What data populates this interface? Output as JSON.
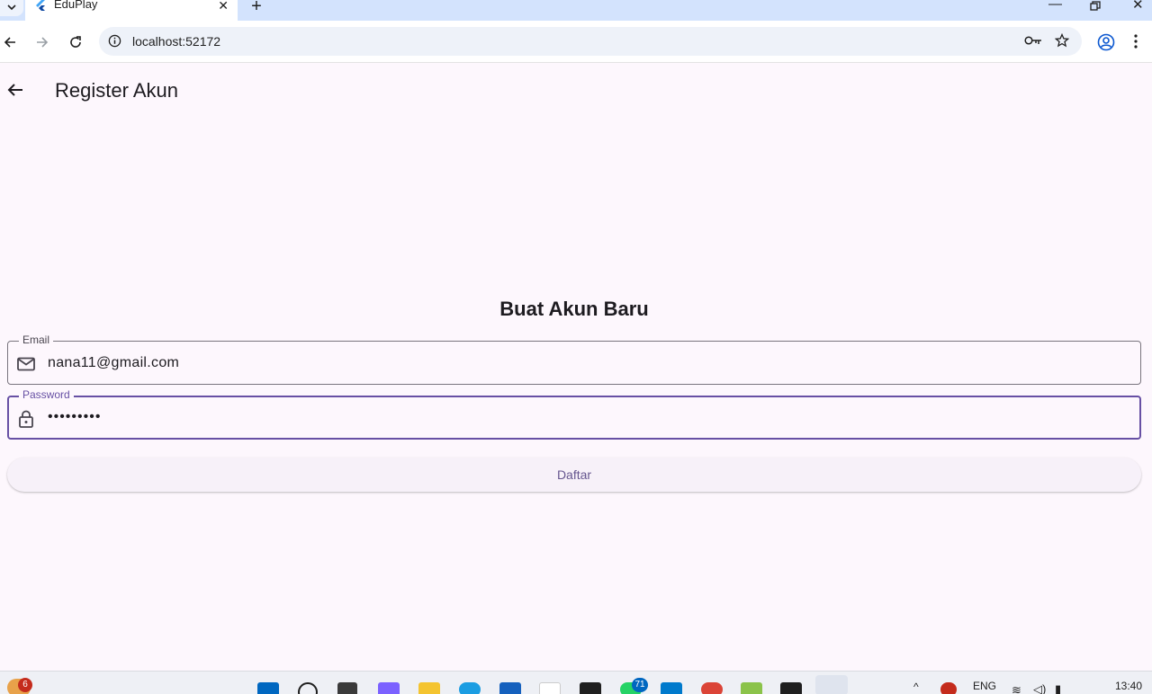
{
  "browser": {
    "tab_title": "EduPlay",
    "url": "localhost:52172"
  },
  "app": {
    "appbar_title": "Register Akun",
    "heading": "Buat Akun Baru",
    "email": {
      "label": "Email",
      "value": "nana11@gmail.com"
    },
    "password": {
      "label": "Password",
      "value": "•••••••••"
    },
    "submit_label": "Daftar"
  },
  "taskbar": {
    "notification_badge": "6",
    "whatsapp_badge": "71",
    "language": "ENG",
    "time": "13:40"
  },
  "colors": {
    "background": "#fdf7fd",
    "primary": "#6750a4",
    "outline": "#79747e",
    "tab_strip": "#d3e3fd"
  }
}
